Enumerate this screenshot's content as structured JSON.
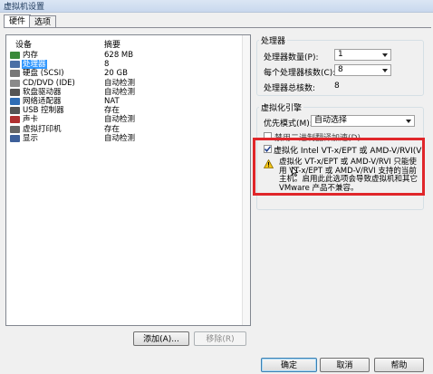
{
  "window": {
    "title": "虚拟机设置"
  },
  "tabs": [
    {
      "label": "硬件"
    },
    {
      "label": "选项"
    }
  ],
  "device_list": {
    "col_device": "设备",
    "col_summary": "摘要",
    "rows": [
      {
        "name": "内存",
        "summary": "628 MB",
        "icon": "memory-icon"
      },
      {
        "name": "处理器",
        "summary": "8",
        "icon": "processor-icon"
      },
      {
        "name": "硬盘 (SCSI)",
        "summary": "20 GB",
        "icon": "hard-disk-icon"
      },
      {
        "name": "CD/DVD (IDE)",
        "summary": "自动检测",
        "icon": "cd-dvd-icon"
      },
      {
        "name": "软盘驱动器",
        "summary": "自动检测",
        "icon": "floppy-icon"
      },
      {
        "name": "网络适配器",
        "summary": "NAT",
        "icon": "network-adapter-icon"
      },
      {
        "name": "USB 控制器",
        "summary": "存在",
        "icon": "usb-icon"
      },
      {
        "name": "声卡",
        "summary": "自动检测",
        "icon": "sound-card-icon"
      },
      {
        "name": "虚拟打印机",
        "summary": "存在",
        "icon": "printer-icon"
      },
      {
        "name": "显示",
        "summary": "自动检测",
        "icon": "display-icon"
      }
    ],
    "selected_index": 1
  },
  "buttons": {
    "add": "添加(A)...",
    "remove": "移除(R)",
    "ok": "确定",
    "cancel": "取消",
    "help": "帮助"
  },
  "processors": {
    "group_label": "处理器",
    "count_label": "处理器数量(P):",
    "count_value": "1",
    "cores_label": "每个处理器核数(C):",
    "cores_value": "8",
    "total_label": "处理器总核数:",
    "total_value": "8"
  },
  "virt_engine": {
    "group_label": "虚拟化引擎",
    "mode_label": "优先模式(M):",
    "mode_value": "自动选择",
    "binary_label": "禁用二进制翻译加速(D)",
    "vtx_label": "虚拟化 Intel VT-x/EPT 或 AMD-V/RVI(V)",
    "vtx_checked": true,
    "warning_text": "虚拟化 VT-x/EPT 或 AMD-V/RVI 只能使用 VT-x/EPT 或 AMD-V/RVI 支持的当前主机。启用此此选项会导致虚拟机和其它 VMware 产品不兼容。"
  },
  "colors": {
    "highlight": "#e0262a",
    "selection": "#3399ff"
  }
}
